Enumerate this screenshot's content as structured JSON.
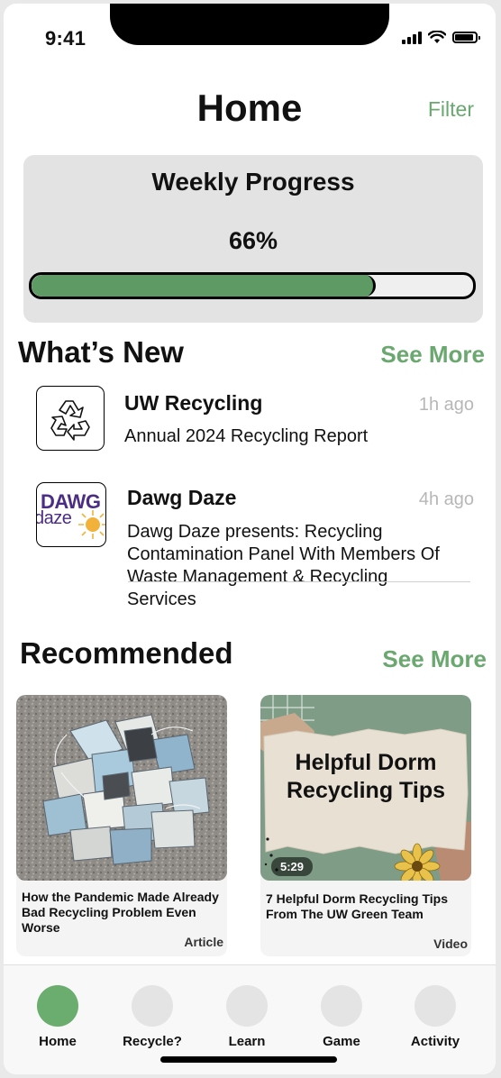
{
  "status_bar": {
    "time": "9:41"
  },
  "header": {
    "title": "Home",
    "filter_label": "Filter"
  },
  "progress": {
    "title": "Weekly Progress",
    "percent_label": "66%",
    "value": 0.78,
    "fill_color": "#5e9a63"
  },
  "whats_new": {
    "title": "What’s New",
    "see_more": "See More",
    "items": [
      {
        "source": "UW Recycling",
        "time": "1h ago",
        "headline": "Annual 2024 Recycling Report",
        "logo_icon": "recycle-icon"
      },
      {
        "source": "Dawg Daze",
        "time": "4h ago",
        "headline": "Dawg Daze presents: Recycling Contamination Panel With Members Of Waste Management & Recycling Services",
        "logo_text_top": "DAWG",
        "logo_text_bottom": "daze"
      }
    ]
  },
  "recommended": {
    "title": "Recommended",
    "see_more": "See More",
    "items": [
      {
        "caption": "How the Pandemic Made Already Bad Recycling Problem Even Worse",
        "type": "Article"
      },
      {
        "caption": "7 Helpful Dorm Recycling Tips From The UW Green Team",
        "type": "Video",
        "duration": "5:29",
        "overlay_title": "Helpful Dorm Recycling Tips"
      }
    ]
  },
  "tabbar": {
    "tabs": [
      {
        "label": "Home",
        "active": true
      },
      {
        "label": "Recycle?",
        "active": false
      },
      {
        "label": "Learn",
        "active": false
      },
      {
        "label": "Game",
        "active": false
      },
      {
        "label": "Activity",
        "active": false
      }
    ]
  },
  "colors": {
    "accent": "#6aa86f",
    "active_tab": "#6aad6e"
  }
}
